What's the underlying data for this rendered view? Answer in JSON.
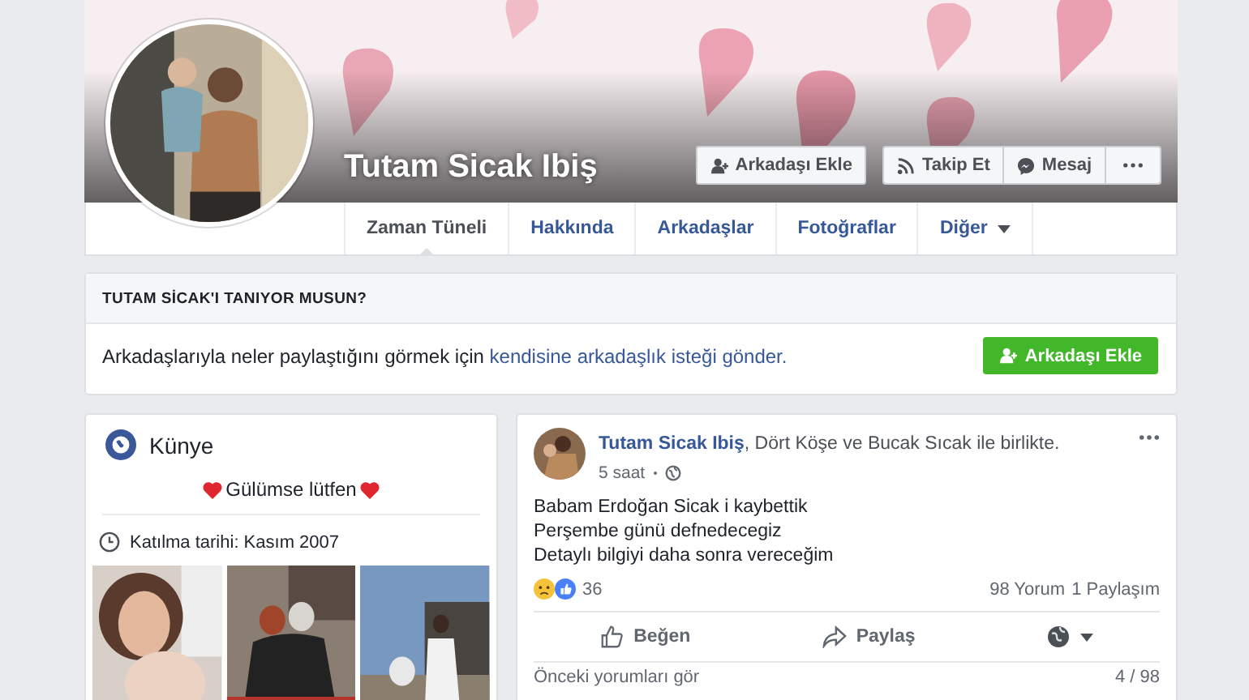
{
  "profile": {
    "name": "Tutam Sicak Ibiş",
    "buttons": [
      {
        "kind": "add-friend",
        "label": "Arkadaşı Ekle"
      },
      {
        "kind": "follow",
        "label": "Takip Et"
      },
      {
        "kind": "message",
        "label": "Mesaj"
      },
      {
        "kind": "more"
      }
    ],
    "tabs": [
      {
        "label": "Zaman Tüneli",
        "selected": true,
        "kind": "link"
      },
      {
        "label": "Hakkında",
        "selected": false,
        "kind": "link"
      },
      {
        "label": "Arkadaşlar",
        "selected": false,
        "kind": "link"
      },
      {
        "label": "Fotoğraflar",
        "selected": false,
        "kind": "link"
      },
      {
        "label": "Diğer",
        "selected": false,
        "kind": "dropdown"
      }
    ]
  },
  "know_card": {
    "title": "TUTAM SİCAK'I TANIYOR MUSUN?",
    "text": "Arkadaşlarıyla neler paylaştığını görmek için",
    "link": "kendisine arkadaşlık isteği gönder.",
    "button": "Arkadaşı Ekle"
  },
  "intro": {
    "title": "Künye",
    "bio": "Gülümse lütfen",
    "joined": "Katılma tarihi: Kasım 2007"
  },
  "post": {
    "header": "**Tutam Sicak Ibiş**, Dört Köşe ve Bucak Sıcak ile birlikte.",
    "time": "5 saat",
    "lines": [
      "Babam Erdoğan Sicak i kaybettik",
      "Perşembe günü defnedecegiz",
      "Detaylı bilgiyi daha sonra vereceğim"
    ],
    "reaction_count": "36",
    "comments": "98 Yorum",
    "shares": "1 Paylaşım",
    "actions": [
      {
        "kind": "like",
        "label": "Beğen"
      },
      {
        "kind": "share",
        "label": "Paylaş"
      }
    ],
    "previous_comments": "Önceki yorumları gör",
    "comment_pager": "4 / 98"
  }
}
